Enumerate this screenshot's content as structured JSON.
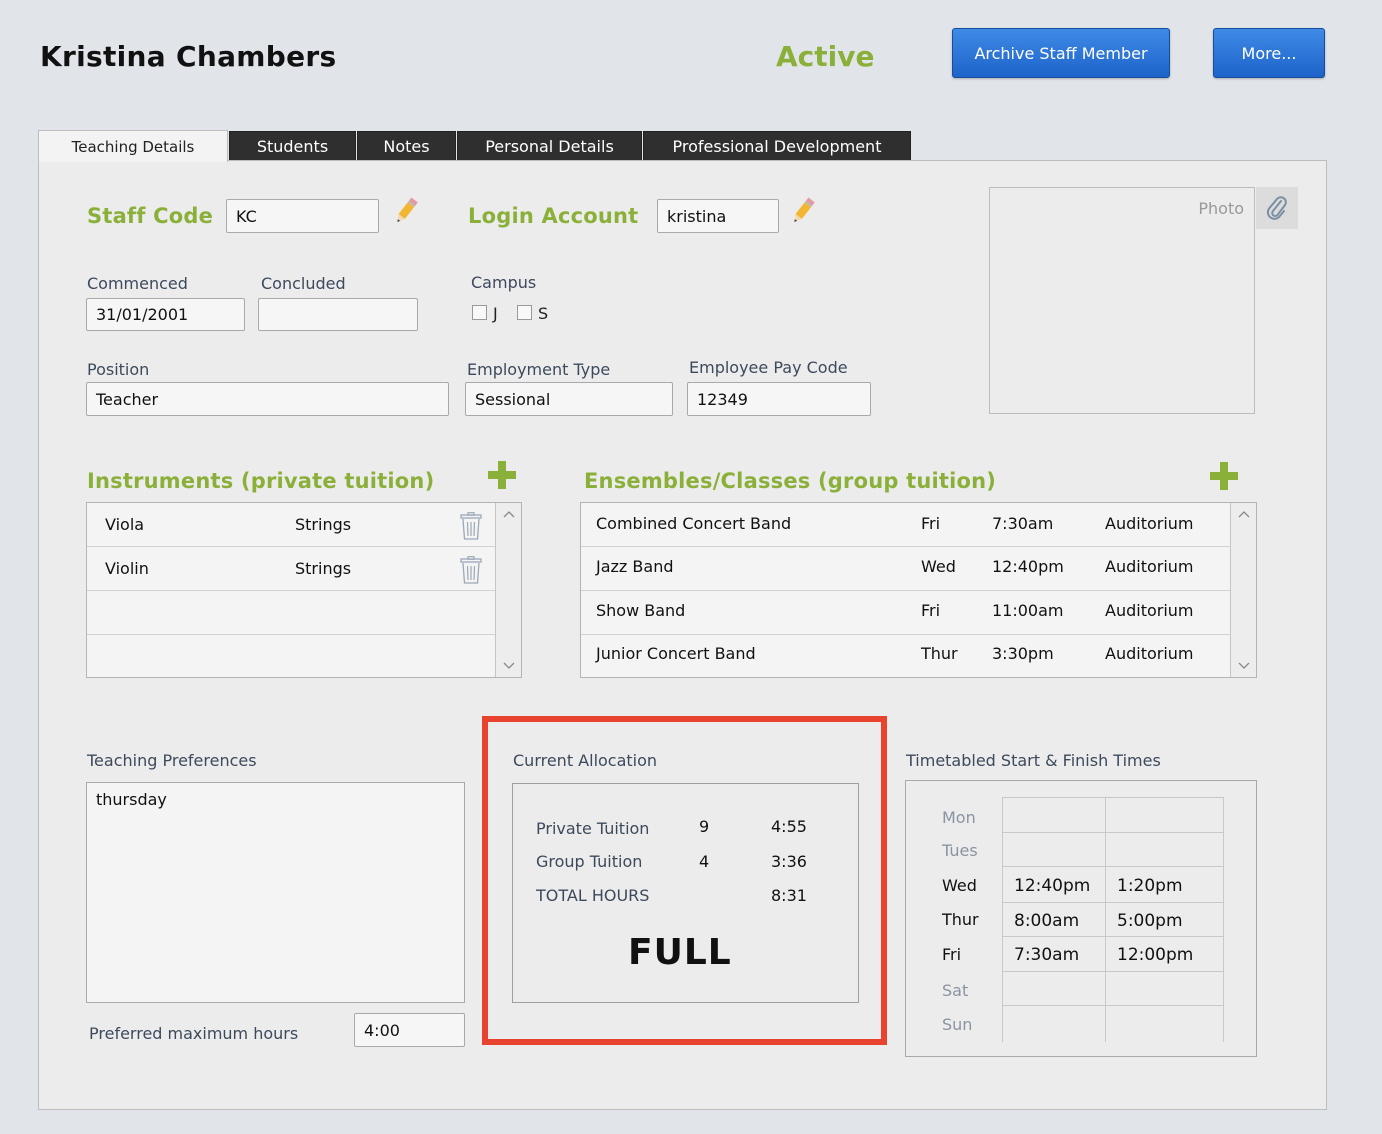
{
  "header": {
    "staff_name": "Kristina Chambers",
    "status": "Active",
    "archive_label": "Archive Staff Member",
    "more_label": "More..."
  },
  "tabs": [
    {
      "label": "Teaching Details",
      "active": true
    },
    {
      "label": "Students",
      "active": false
    },
    {
      "label": "Notes",
      "active": false
    },
    {
      "label": "Personal Details",
      "active": false
    },
    {
      "label": "Professional Development",
      "active": false
    }
  ],
  "details": {
    "staff_code_label": "Staff Code",
    "staff_code": "KC",
    "login_label": "Login Account",
    "login": "kristina",
    "commenced_label": "Commenced",
    "commenced": "31/01/2001",
    "concluded_label": "Concluded",
    "concluded": "",
    "campus_label": "Campus",
    "campus_options": [
      {
        "label": "J",
        "checked": false
      },
      {
        "label": "S",
        "checked": false
      }
    ],
    "position_label": "Position",
    "position": "Teacher",
    "employment_type_label": "Employment Type",
    "employment_type": "Sessional",
    "pay_code_label": "Employee Pay Code",
    "pay_code": "12349",
    "photo_label": "Photo"
  },
  "instruments": {
    "title": "Instruments (private tuition)",
    "rows": [
      {
        "instrument": "Viola",
        "family": "Strings"
      },
      {
        "instrument": "Violin",
        "family": "Strings"
      }
    ]
  },
  "ensembles": {
    "title": "Ensembles/Classes (group tuition)",
    "rows": [
      {
        "name": "Combined Concert Band",
        "day": "Fri",
        "time": "7:30am",
        "location": "Auditorium"
      },
      {
        "name": "Jazz Band",
        "day": "Wed",
        "time": "12:40pm",
        "location": "Auditorium"
      },
      {
        "name": "Show Band",
        "day": "Fri",
        "time": "11:00am",
        "location": "Auditorium"
      },
      {
        "name": "Junior Concert Band",
        "day": "Thur",
        "time": "3:30pm",
        "location": "Auditorium"
      }
    ]
  },
  "preferences": {
    "label": "Teaching Preferences",
    "text": "thursday",
    "max_hours_label": "Preferred maximum hours",
    "max_hours": "4:00"
  },
  "allocation": {
    "label": "Current Allocation",
    "rows": [
      {
        "label": "Private Tuition",
        "count": "9",
        "hours": "4:55"
      },
      {
        "label": "Group Tuition",
        "count": "4",
        "hours": "3:36"
      },
      {
        "label": "TOTAL HOURS",
        "count": "",
        "hours": "8:31"
      }
    ],
    "status": "FULL",
    "highlight_color": "#e8432e"
  },
  "timetable": {
    "label": "Timetabled Start & Finish Times",
    "days": [
      {
        "day": "Mon",
        "start": "",
        "finish": "",
        "active": false
      },
      {
        "day": "Tues",
        "start": "",
        "finish": "",
        "active": false
      },
      {
        "day": "Wed",
        "start": "12:40pm",
        "finish": "1:20pm",
        "active": true
      },
      {
        "day": "Thur",
        "start": "8:00am",
        "finish": "5:00pm",
        "active": true
      },
      {
        "day": "Fri",
        "start": "7:30am",
        "finish": "12:00pm",
        "active": true
      },
      {
        "day": "Sat",
        "start": "",
        "finish": "",
        "active": false
      },
      {
        "day": "Sun",
        "start": "",
        "finish": "",
        "active": false
      }
    ]
  },
  "colors": {
    "accent_green": "#8bb03a",
    "button_blue": "#2a74d8",
    "tab_dark": "#2f2f2f"
  }
}
